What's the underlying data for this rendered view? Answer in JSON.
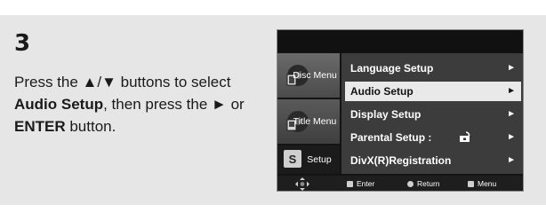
{
  "step": {
    "number": "3"
  },
  "instruction": {
    "part1": "Press the ",
    "arrows": "▲/▼",
    "part2": " buttons to select ",
    "bold1": "Audio Setup",
    "part3": ", then press the ",
    "enter_arrow": "►",
    "part4": " or ",
    "bold2": "ENTER",
    "part5": " button."
  },
  "osd": {
    "side": [
      {
        "label": "Disc Menu",
        "icon": "disc-menu-icon"
      },
      {
        "label": "Title Menu",
        "icon": "title-menu-icon"
      },
      {
        "label": "Setup",
        "icon": "setup-icon"
      }
    ],
    "menu": [
      {
        "label": "Language Setup",
        "arrow": "►",
        "selected": false
      },
      {
        "label": "Audio Setup",
        "arrow": "►",
        "selected": true
      },
      {
        "label": "Display Setup",
        "arrow": "►",
        "selected": false
      },
      {
        "label": "Parental Setup :",
        "arrow": "►",
        "selected": false,
        "icon": "lock-icon"
      },
      {
        "label": "DivX(R)Registration",
        "arrow": "►",
        "selected": false
      }
    ],
    "bottom": {
      "nav_icon": "navigation-arrows-icon",
      "enter": "Enter",
      "return": "Return",
      "menu": "Menu"
    }
  },
  "colors": {
    "panel_bg": "#e6e6e6",
    "screen_bg": "#141414",
    "selected_bg": "#e9e9e9",
    "text": "#1a1a1a"
  }
}
